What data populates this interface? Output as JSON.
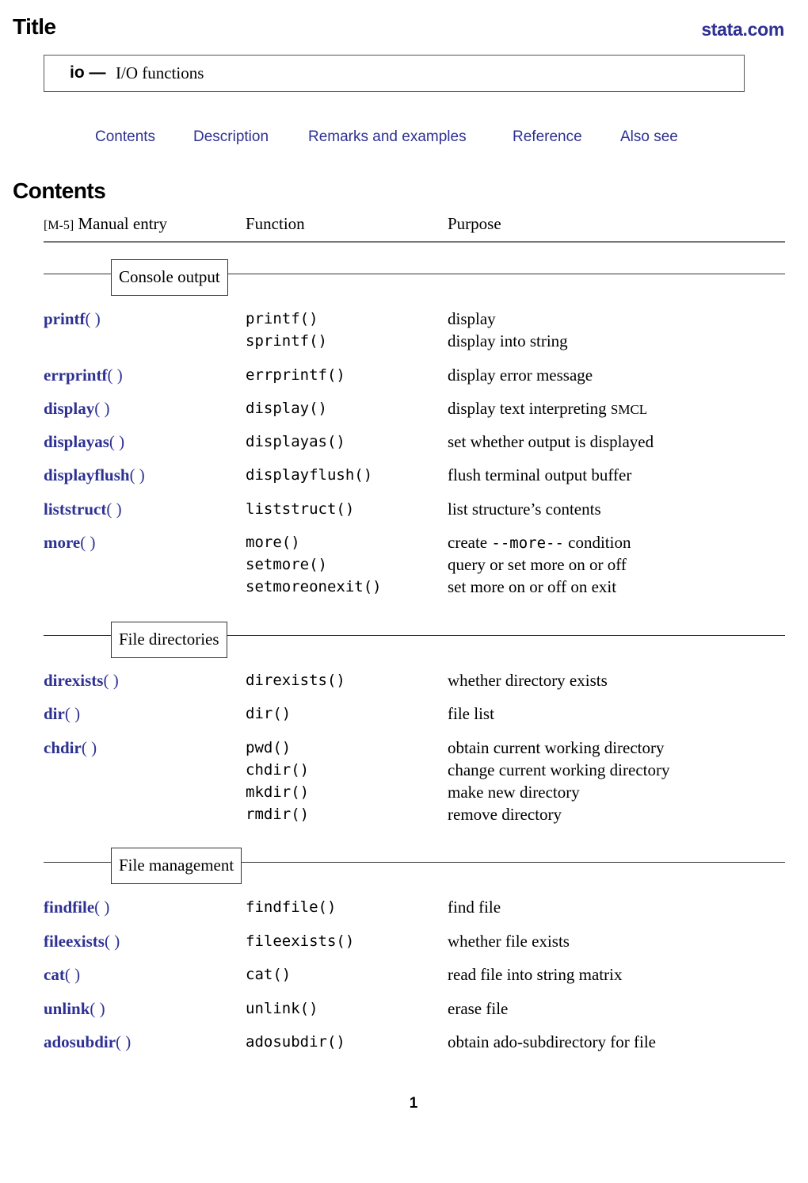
{
  "header": {
    "title": "Title",
    "site_link": "stata.com"
  },
  "entry": {
    "name": "io —",
    "description": "I/O functions"
  },
  "nav": {
    "links": [
      "Contents",
      "Description",
      "Remarks and examples",
      "Reference",
      "Also see"
    ]
  },
  "contents": {
    "heading": "Contents",
    "columns": {
      "manual_prefix": "[M-5]",
      "manual_entry": "Manual entry",
      "function": "Function",
      "purpose": "Purpose"
    },
    "sections": [
      {
        "title": "Console output",
        "entries": [
          {
            "entry": "printf",
            "functions": [
              "printf()",
              "sprintf()"
            ],
            "purposes": [
              "display",
              "display into string"
            ]
          },
          {
            "entry": "errprintf",
            "functions": [
              "errprintf()"
            ],
            "purposes": [
              "display error message"
            ]
          },
          {
            "entry": "display",
            "functions": [
              "display()"
            ],
            "purposes": [
              "display text interpreting SMCL"
            ]
          },
          {
            "entry": "displayas",
            "functions": [
              "displayas()"
            ],
            "purposes": [
              "set whether output is displayed"
            ]
          },
          {
            "entry": "displayflush",
            "functions": [
              "displayflush()"
            ],
            "purposes": [
              "flush terminal output buffer"
            ]
          },
          {
            "entry": "liststruct",
            "functions": [
              "liststruct()"
            ],
            "purposes": [
              "list structure’s contents"
            ]
          },
          {
            "entry": "more",
            "functions": [
              "more()",
              "setmore()",
              "setmoreonexit()"
            ],
            "purposes": [
              "create --more-- condition",
              "query or set more on or off",
              "set more on or off on exit"
            ]
          }
        ]
      },
      {
        "title": "File directories",
        "entries": [
          {
            "entry": "direxists",
            "functions": [
              "direxists()"
            ],
            "purposes": [
              "whether directory exists"
            ]
          },
          {
            "entry": "dir",
            "functions": [
              "dir()"
            ],
            "purposes": [
              "file list"
            ]
          },
          {
            "entry": "chdir",
            "functions": [
              "pwd()",
              "chdir()",
              "mkdir()",
              "rmdir()"
            ],
            "purposes": [
              "obtain current working directory",
              "change current working directory",
              "make new directory",
              "remove directory"
            ]
          }
        ]
      },
      {
        "title": "File management",
        "entries": [
          {
            "entry": "findfile",
            "functions": [
              "findfile()"
            ],
            "purposes": [
              "find file"
            ]
          },
          {
            "entry": "fileexists",
            "functions": [
              "fileexists()"
            ],
            "purposes": [
              "whether file exists"
            ]
          },
          {
            "entry": "cat",
            "functions": [
              "cat()"
            ],
            "purposes": [
              "read file into string matrix"
            ]
          },
          {
            "entry": "unlink",
            "functions": [
              "unlink()"
            ],
            "purposes": [
              "erase file"
            ]
          },
          {
            "entry": "adosubdir",
            "functions": [
              "adosubdir()"
            ],
            "purposes": [
              "obtain ado-subdirectory for file"
            ]
          }
        ]
      }
    ]
  },
  "footer": {
    "page_number": "1"
  },
  "colors": {
    "link": "#2e3192",
    "text": "#000000",
    "rule": "#777777"
  }
}
